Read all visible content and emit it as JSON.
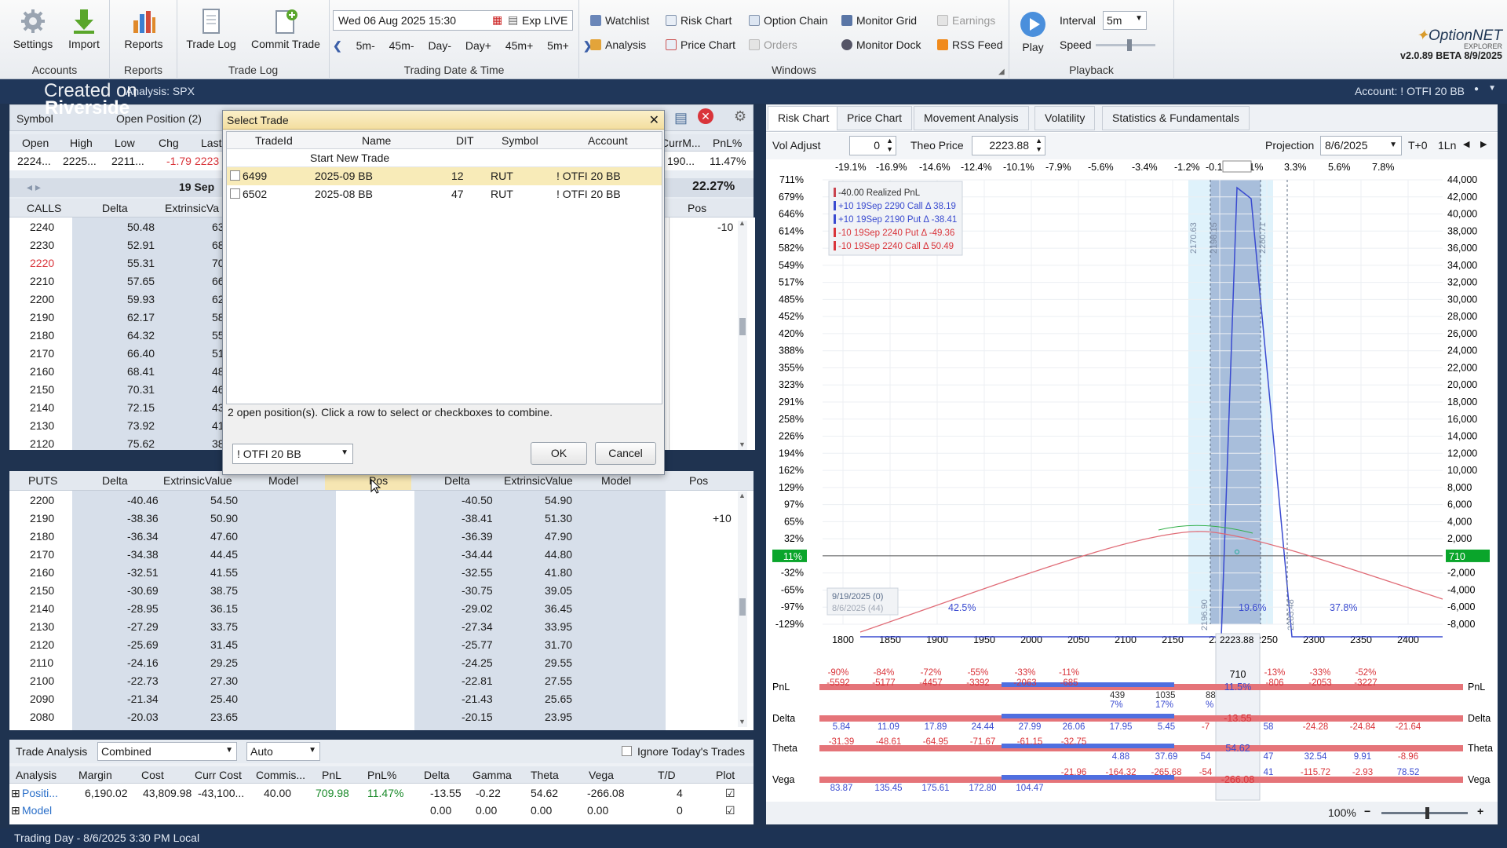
{
  "ribbon": {
    "settings": "Settings",
    "import": "Import",
    "reports": "Reports",
    "trade_log": "Trade Log",
    "commit_trade": "Commit Trade",
    "g_accounts": "Accounts",
    "g_reports": "Reports",
    "g_tradelog": "Trade Log",
    "g_datetime": "Trading Date & Time",
    "g_windows": "Windows",
    "g_playback": "Playback",
    "datetime": "Wed 06 Aug 2025 15:30",
    "exp": "Exp LIVE",
    "nav": [
      "5m-",
      "45m-",
      "Day-",
      "Day+",
      "45m+",
      "5m+"
    ],
    "windows": [
      "Watchlist",
      "Risk Chart",
      "Option Chain",
      "Monitor Grid",
      "Earnings",
      "Analysis",
      "Price Chart",
      "Orders",
      "Monitor Dock",
      "RSS Feed"
    ],
    "play": "Play",
    "interval_label": "Interval",
    "interval_value": "5m",
    "speed_label": "Speed",
    "brand": "OptionNET",
    "brand_sub": "EXPLORER",
    "version": "v2.0.89 BETA 8/9/2025"
  },
  "subbar": {
    "left": "Analysis: SPX",
    "watermark1": "Created on",
    "watermark2": "Riverside",
    "account": "Account: ! OTFI 20 BB"
  },
  "quote": {
    "symbol_tab": "Symbol",
    "open_pos_tab": "Open Position (2)",
    "headers": [
      "Open",
      "High",
      "Low",
      "Chg",
      "Last"
    ],
    "values": [
      "2224...",
      "2225...",
      "2211...",
      "-1.79",
      "2223"
    ],
    "right_headers": [
      "CurrM...",
      "PnL%"
    ],
    "right_values": [
      "190...",
      "11.47%"
    ],
    "pct_big": "22.27%"
  },
  "calls": {
    "expiry": "19 Sep",
    "label": "CALLS",
    "headers": [
      "Delta",
      "ExtrinsicVa"
    ],
    "pos_header": "Pos",
    "rows": [
      [
        "2240",
        "50.48",
        "63"
      ],
      [
        "2230",
        "52.91",
        "68"
      ],
      [
        "2220",
        "55.31",
        "70"
      ],
      [
        "2210",
        "57.65",
        "66"
      ],
      [
        "2200",
        "59.93",
        "62"
      ],
      [
        "2190",
        "62.17",
        "58"
      ],
      [
        "2180",
        "64.32",
        "55"
      ],
      [
        "2170",
        "66.40",
        "51"
      ],
      [
        "2160",
        "68.41",
        "48"
      ],
      [
        "2150",
        "70.31",
        "46"
      ],
      [
        "2140",
        "72.15",
        "43"
      ],
      [
        "2130",
        "73.92",
        "41"
      ],
      [
        "2120",
        "75.62",
        "38"
      ]
    ],
    "pos_first": "-10"
  },
  "puts": {
    "label": "PUTS",
    "headers": [
      "Delta",
      "ExtrinsicValue",
      "Model",
      "Pos",
      "Delta",
      "ExtrinsicValue",
      "Model",
      "Pos"
    ],
    "rows": [
      [
        "2200",
        "-40.46",
        "54.50",
        "-40.50",
        "54.90",
        ""
      ],
      [
        "2190",
        "-38.36",
        "50.90",
        "-38.41",
        "51.30",
        "+10"
      ],
      [
        "2180",
        "-36.34",
        "47.60",
        "-36.39",
        "47.90",
        ""
      ],
      [
        "2170",
        "-34.38",
        "44.45",
        "-34.44",
        "44.80",
        ""
      ],
      [
        "2160",
        "-32.51",
        "41.55",
        "-32.55",
        "41.80",
        ""
      ],
      [
        "2150",
        "-30.69",
        "38.75",
        "-30.75",
        "39.05",
        ""
      ],
      [
        "2140",
        "-28.95",
        "36.15",
        "-29.02",
        "36.45",
        ""
      ],
      [
        "2130",
        "-27.29",
        "33.75",
        "-27.34",
        "33.95",
        ""
      ],
      [
        "2120",
        "-25.69",
        "31.45",
        "-25.77",
        "31.70",
        ""
      ],
      [
        "2110",
        "-24.16",
        "29.25",
        "-24.25",
        "29.55",
        ""
      ],
      [
        "2100",
        "-22.73",
        "27.30",
        "-22.81",
        "27.55",
        ""
      ],
      [
        "2090",
        "-21.34",
        "25.40",
        "-21.43",
        "25.65",
        ""
      ],
      [
        "2080",
        "-20.03",
        "23.65",
        "-20.15",
        "23.95",
        ""
      ]
    ]
  },
  "dialog": {
    "title": "Select Trade",
    "headers": [
      "TradeId",
      "Name",
      "DIT",
      "Symbol",
      "Account"
    ],
    "new_row": "Start New Trade",
    "rows": [
      [
        "6499",
        "2025-09 BB",
        "12",
        "RUT",
        "! OTFI 20 BB"
      ],
      [
        "6502",
        "2025-08 BB",
        "47",
        "RUT",
        "! OTFI 20 BB"
      ]
    ],
    "hint": "2 open position(s). Click a row to select or checkboxes to combine.",
    "account_select": "! OTFI 20 BB",
    "ok": "OK",
    "cancel": "Cancel"
  },
  "analysis": {
    "label": "Trade Analysis",
    "mode": "Combined",
    "auto": "Auto",
    "ignore": "Ignore Today's Trades",
    "headers": [
      "Analysis",
      "Margin",
      "Cost",
      "Curr Cost",
      "Commis...",
      "PnL",
      "PnL%",
      "Delta",
      "Gamma",
      "Theta",
      "Vega",
      "T/D",
      "Plot"
    ],
    "row1": [
      "Positi...",
      "6,190.02",
      "43,809.98",
      "-43,100...",
      "40.00",
      "709.98",
      "11.47%",
      "-13.55",
      "-0.22",
      "54.62",
      "-266.08",
      "4"
    ],
    "row2": [
      "Model",
      "",
      "",
      "",
      "",
      "",
      "",
      "0.00",
      "0.00",
      "0.00",
      "0.00",
      "0"
    ]
  },
  "status": "Trading Day - 8/6/2025 3:30 PM Local",
  "risk": {
    "tabs": [
      "Risk Chart",
      "Price Chart",
      "Movement Analysis",
      "Volatility",
      "Statistics & Fundamentals"
    ],
    "vol_adjust_label": "Vol Adjust",
    "vol_adjust": "0",
    "theo_label": "Theo Price",
    "theo": "2223.88",
    "proj_label": "Projection",
    "proj": "8/6/2025",
    "t0": "T+0",
    "oneln": "1Ln",
    "top_pcts": [
      "-19.1%",
      "-16.9%",
      "-14.6%",
      "-12.4%",
      "-10.1%",
      "-7.9%",
      "-5.6%",
      "-3.4%",
      "-1.2%",
      "-0.1%",
      "1.1%",
      "3.3%",
      "5.6%",
      "7.8%"
    ],
    "left_axis": [
      "711%",
      "679%",
      "646%",
      "614%",
      "582%",
      "549%",
      "517%",
      "485%",
      "452%",
      "420%",
      "388%",
      "355%",
      "323%",
      "291%",
      "258%",
      "226%",
      "194%",
      "162%",
      "129%",
      "97%",
      "65%",
      "32%",
      "0%",
      "-32%",
      "-65%",
      "-97%",
      "-129%"
    ],
    "right_axis": [
      "44,000",
      "42,000",
      "40,000",
      "38,000",
      "36,000",
      "34,000",
      "32,000",
      "30,000",
      "28,000",
      "26,000",
      "24,000",
      "22,000",
      "20,000",
      "18,000",
      "16,000",
      "14,000",
      "12,000",
      "10,000",
      "8,000",
      "6,000",
      "4,000",
      "2,000",
      "0",
      "-2,000",
      "-4,000",
      "-6,000",
      "-8,000"
    ],
    "x_axis": [
      "1800",
      "1850",
      "1900",
      "1950",
      "2000",
      "2050",
      "2100",
      "2150",
      "2200",
      "2250",
      "2300",
      "2350",
      "2400"
    ],
    "left_badge": "11%",
    "right_badge": "710",
    "legend": [
      "-40.00 Realized PnL",
      "+10 19Sep 2290 Call Δ  38.19",
      "+10 19Sep 2190 Put Δ  -38.41",
      "-10 19Sep 2240 Put Δ  -49.36",
      "-10 19Sep 2240 Call Δ  50.49"
    ],
    "dates": [
      "9/19/2025 (0)",
      "8/6/2025 (44)"
    ],
    "vlabels": [
      "2170.63",
      "2198.15",
      "2280.71",
      "2196.90",
      "2283.48"
    ],
    "pct_labels": [
      "42.5%",
      "19.6%",
      "37.8%"
    ],
    "price_box": "2223.88",
    "row_labels": [
      "PnL",
      "Delta",
      "Theta",
      "Vega"
    ],
    "pnl_vals": [
      "-90%",
      "-84%",
      "-72%",
      "-55%",
      "-33%",
      "-11%",
      "-13%",
      "-33%",
      "-52%"
    ],
    "pnl_amts": [
      "-5592",
      "-5177",
      "-4457",
      "-3392",
      "-2063",
      "-685",
      "-806",
      "-2053",
      "-3227"
    ],
    "pnl_pos": [
      "439",
      "1035",
      "88"
    ],
    "pnl_pos_pct": [
      "7%",
      "17%",
      "%"
    ],
    "center": [
      "710",
      "11.5%",
      "-13.55",
      "54.62",
      "-266.08"
    ],
    "delta_vals": [
      "5.84",
      "11.09",
      "17.89",
      "24.44",
      "27.99",
      "26.06",
      "17.95",
      "5.45",
      "-7",
      "58",
      "-24.28",
      "-24.84",
      "-21.64"
    ],
    "theta_vals": [
      "-31.39",
      "-48.61",
      "-64.95",
      "-71.67",
      "-61.15",
      "-32.75",
      "4.88",
      "37.69",
      "54",
      "47",
      "32.54",
      "9.91",
      "-8.96"
    ],
    "vega_vals": [
      "83.87",
      "135.45",
      "175.61",
      "172.80",
      "104.47",
      "-21.96",
      "-164.32",
      "-265.68",
      "-54",
      "41",
      "-115.72",
      "-2.93",
      "78.52"
    ],
    "zoom": "100%"
  },
  "colors": {
    "accent": "#1f3350",
    "badge_green": "#0aa52b",
    "call_red": "#d9343a",
    "put_blue": "#3a4bd0"
  }
}
